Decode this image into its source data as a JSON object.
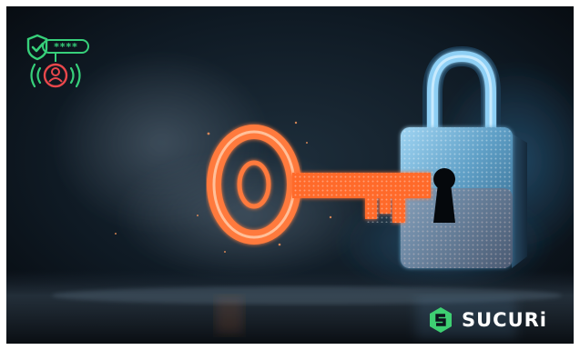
{
  "badge": {
    "password_mask": "****",
    "shield_icon": "shield-check-icon",
    "user_icon": "user-signal-icon",
    "color": "#37d07a",
    "alert_color": "#e8474b"
  },
  "illustration": {
    "key_color": "#ff7a3c",
    "lock_color": "#6fb9e6"
  },
  "brand": {
    "name": "SUCURi",
    "logo_icon": "sucuri-logo-icon",
    "logo_color": "#3ecf72"
  }
}
